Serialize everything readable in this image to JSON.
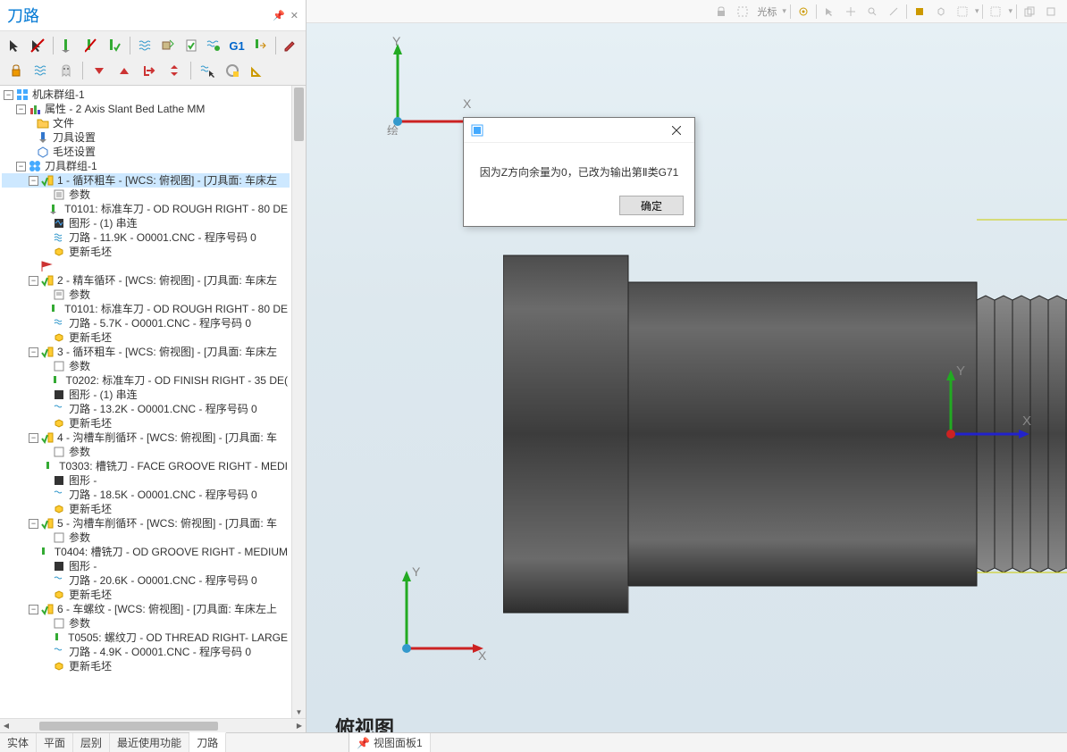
{
  "panel": {
    "title": "刀路"
  },
  "tree": {
    "root": "机床群组-1",
    "props": "属性 - 2 Axis Slant Bed Lathe MM",
    "files": "文件",
    "toolset": "刀具设置",
    "stock": "毛坯设置",
    "toolgroup": "刀具群组-1",
    "ops": [
      {
        "title": "1 - 循环粗车 - [WCS: 俯视图] - [刀具面: 车床左",
        "params": "参数",
        "tool": "T0101: 标准车刀 - OD ROUGH RIGHT - 80 DE",
        "geom": "图形 -  (1) 串连",
        "path": "刀路 - 11.9K - O0001.CNC - 程序号码 0",
        "stock": "更新毛坯",
        "selected": true
      },
      {
        "title": "2 - 精车循环 - [WCS: 俯视图] - [刀具面: 车床左",
        "params": "参数",
        "tool": "T0101: 标准车刀 - OD ROUGH RIGHT - 80 DE",
        "path": "刀路 - 5.7K - O0001.CNC - 程序号码 0",
        "stock": "更新毛坯"
      },
      {
        "title": "3 - 循环粗车 - [WCS: 俯视图] - [刀具面: 车床左",
        "params": "参数",
        "tool": "T0202: 标准车刀 - OD FINISH RIGHT - 35 DE(",
        "geom": "图形 -  (1) 串连",
        "path": "刀路 - 13.2K - O0001.CNC - 程序号码 0",
        "stock": "更新毛坯"
      },
      {
        "title": "4 - 沟槽车削循环 - [WCS: 俯视图] - [刀具面: 车",
        "params": "参数",
        "tool": "T0303: 槽铣刀 - FACE GROOVE RIGHT - MEDI",
        "geom": "图形 -",
        "path": "刀路 - 18.5K - O0001.CNC - 程序号码 0",
        "stock": "更新毛坯"
      },
      {
        "title": "5 - 沟槽车削循环 - [WCS: 俯视图] - [刀具面: 车",
        "params": "参数",
        "tool": "T0404: 槽铣刀 - OD GROOVE RIGHT - MEDIUM",
        "geom": "图形 -",
        "path": "刀路 - 20.6K - O0001.CNC - 程序号码 0",
        "stock": "更新毛坯"
      },
      {
        "title": "6 - 车螺纹 - [WCS: 俯视图] - [刀具面: 车床左上",
        "params": "参数",
        "tool": "T0505: 螺纹刀 - OD THREAD RIGHT- LARGE",
        "path": "刀路 - 4.9K - O0001.CNC - 程序号码 0",
        "stock": "更新毛坯"
      }
    ]
  },
  "viewport": {
    "label_tl": "绘",
    "view_name": "俯视图",
    "toolbar_text": "光标"
  },
  "dialog": {
    "message": "因为Z方向余量为0，已改为输出第Ⅱ类G71",
    "ok": "确定"
  },
  "tabs": {
    "left": [
      "实体",
      "平面",
      "层别",
      "最近使用功能",
      "刀路"
    ],
    "active_left": "刀路",
    "viewport_tab": "视图面板1"
  }
}
